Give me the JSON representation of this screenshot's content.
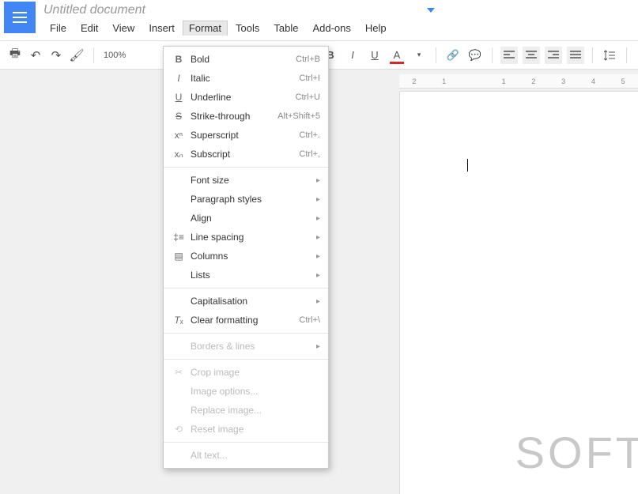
{
  "doc": {
    "title": "Untitled document"
  },
  "menubar": {
    "file": "File",
    "edit": "Edit",
    "view": "View",
    "insert": "Insert",
    "format": "Format",
    "tools": "Tools",
    "table": "Table",
    "addons": "Add-ons",
    "help": "Help"
  },
  "toolbar": {
    "zoom": "100%"
  },
  "format_menu": {
    "bold": {
      "label": "Bold",
      "shortcut": "Ctrl+B"
    },
    "italic": {
      "label": "Italic",
      "shortcut": "Ctrl+I"
    },
    "underline": {
      "label": "Underline",
      "shortcut": "Ctrl+U"
    },
    "strike": {
      "label": "Strike-through",
      "shortcut": "Alt+Shift+5"
    },
    "superscript": {
      "label": "Superscript",
      "shortcut": "Ctrl+."
    },
    "subscript": {
      "label": "Subscript",
      "shortcut": "Ctrl+,"
    },
    "fontsize": {
      "label": "Font size"
    },
    "paragraph": {
      "label": "Paragraph styles"
    },
    "align": {
      "label": "Align"
    },
    "linespacing": {
      "label": "Line spacing"
    },
    "columns": {
      "label": "Columns"
    },
    "lists": {
      "label": "Lists"
    },
    "capitalisation": {
      "label": "Capitalisation"
    },
    "clear": {
      "label": "Clear formatting",
      "shortcut": "Ctrl+\\"
    },
    "borders": {
      "label": "Borders & lines"
    },
    "crop": {
      "label": "Crop image"
    },
    "imgopts": {
      "label": "Image options..."
    },
    "replaceimg": {
      "label": "Replace image..."
    },
    "resetimg": {
      "label": "Reset image"
    },
    "alttext": {
      "label": "Alt text..."
    }
  },
  "ruler": [
    "2",
    "1",
    "",
    "1",
    "2",
    "3",
    "4",
    "5"
  ],
  "watermark": "SOFT"
}
